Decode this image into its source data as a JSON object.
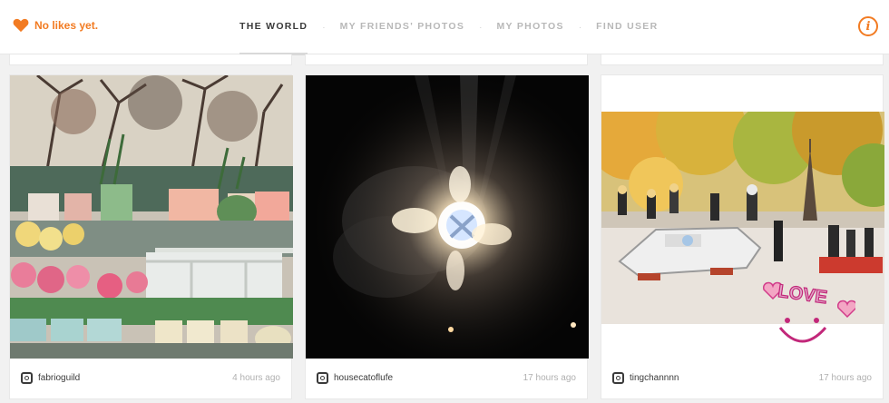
{
  "header": {
    "likes_label": "No likes yet.",
    "tabs": [
      {
        "label": "THE WORLD",
        "active": true
      },
      {
        "label": "MY FRIENDS' PHOTOS",
        "active": false
      },
      {
        "label": "MY PHOTOS",
        "active": false
      },
      {
        "label": "FIND USER",
        "active": false
      }
    ],
    "info_label": "i"
  },
  "colors": {
    "accent": "#f27b22",
    "active_tab": "#3a3a3a",
    "inactive_tab": "#b8b8b8"
  },
  "photos": [
    {
      "username": "fabrioguild",
      "time": "4 hours ago",
      "icon": "instagram-icon",
      "subject": "flower shop with potted plants"
    },
    {
      "username": "housecatoflufe",
      "time": "17 hours ago",
      "icon": "instagram-icon",
      "subject": "sparkler firework at night"
    },
    {
      "username": "tingchannnn",
      "time": "17 hours ago",
      "icon": "instagram-icon",
      "subject": "lego figures with LOVE sticker"
    }
  ],
  "stickers": {
    "love_text": "LOVE"
  }
}
